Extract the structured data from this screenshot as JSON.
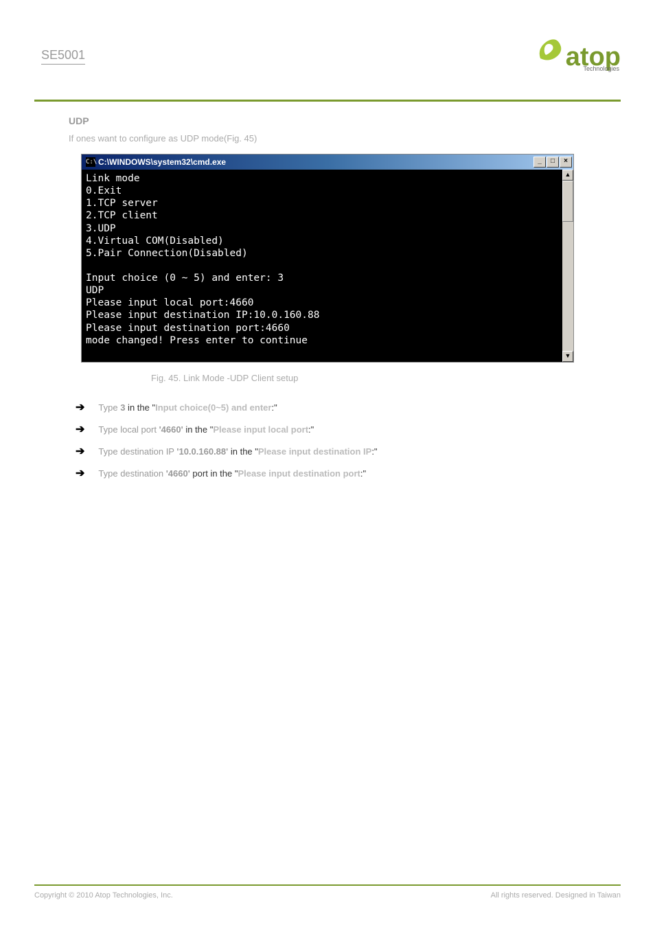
{
  "header": {
    "model": "SE5001",
    "logo_brand": "atop",
    "logo_sub": "Technologies"
  },
  "section": {
    "label": "UDP",
    "intro": "If ones want to configure as UDP mode(Fig. 45)"
  },
  "console": {
    "title_path": "C:\\WINDOWS\\system32\\cmd.exe",
    "icon_label": "C:\\",
    "lines": "Link mode\n0.Exit\n1.TCP server\n2.TCP client\n3.UDP\n4.Virtual COM(Disabled)\n5.Pair Connection(Disabled)\n\nInput choice (0 ~ 5) and enter: 3\nUDP\nPlease input local port:4660\nPlease input destination IP:10.0.160.88\nPlease input destination port:4660\nmode changed! Press enter to continue"
  },
  "figure_caption": "Fig. 45. Link Mode -UDP Client setup",
  "bullets": {
    "b1_pre": "Type ",
    "b1_val": "3",
    "b1_mid": " in the \"",
    "b1_field": "Input choice(0~5) and enter",
    "b1_suf": ":\"",
    "b2_pre": "Type local port",
    "b2_val": "'4660'",
    "b2_mid": "in the \"",
    "b2_field": "Please input local port",
    "b2_suf": ":\"",
    "b3_pre": "Type destination IP",
    "b3_val": "'10.0.160.88'",
    "b3_mid": "in the \"",
    "b3_field": "Please input destination IP",
    "b3_suf": ":\"",
    "b4_pre": "Type destination",
    "b4_val": " '4660' ",
    "b4_mid": "port in the \"",
    "b4_field": "Please input destination port",
    "b4_suf": ":\""
  },
  "footer": {
    "copyright": "Copyright © 2010 Atop Technologies, Inc.",
    "rights": "All rights reserved. Designed in Taiwan"
  }
}
